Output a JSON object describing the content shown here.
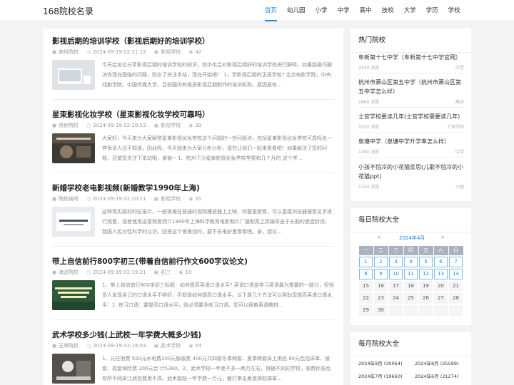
{
  "site": {
    "logo": "168院校名录"
  },
  "nav": [
    "首页",
    "幼儿园",
    "小学",
    "中学",
    "高中",
    "技校",
    "大学",
    "学历",
    "学校"
  ],
  "articles": [
    {
      "title": "影视后期的培训学校（影视后期好的培训学校）",
      "author": "商科院校",
      "date": "2024-09-19 02:21:12",
      "category": "影视学校",
      "views": "42",
      "excerpt": "今天给各位分享影视后期的培训学校的知识，其中也会对影视后期好的培训学校进行解释，如果能碰巧解决你现在面临的问题，别忘了关注本站，现在开始吧！ 1、学影视后期的正规学校? 北京电影学院，中央戏剧学院，中国传媒大学。目前国内有很多影视后期制作的培训机构，原因是有...",
      "thumb_bg": "#dfe3e8",
      "thumb_fg": "#ffffff"
    },
    {
      "title": "星束影视化妆学校（星束影视化妆学校可靠吗）",
      "author": "京剧院校",
      "date": "2024-09-19 02:20:53",
      "category": "影视学校",
      "views": "39",
      "excerpt": "大家好，今天来为大家解答星束影视化妆学校这个问题的一些问题点，包括星束影视化妆学校可靠吗也一样很多人还不知道，因此呢，今天就来为大家分析分析，现在让我们一起来看看吧！如果解决了您的问题，还望您关注下本站哦，谢谢~ 1、杭州下沙星束影视化妆学校学费和几个月的 这个学...",
      "thumb_bg": "#3d3a36",
      "thumb_fg": "#d8c9b0"
    },
    {
      "title": "新婚学校老电影视频(新婚教学1990年上海)",
      "author": "院校编号",
      "date": "2024-09-19 02:20:11",
      "category": "影视学校",
      "views": "31",
      "excerpt": "这种现实题材的纪录片，一般很难在普通的视频播放器上上映，你要是想看，可以直接浏览器搜索名字进行观看，或者使用迅雷观看而介1990年上海科学教育电影制片厂摄制英之英编导由于长期的思想封闭，我国人民对性科学的认识。回答这个很难找的，要不去电驴里看看吧。亲，建议...",
      "thumb_bg": "#e9ebee",
      "thumb_fg": "#4a5560"
    },
    {
      "title": "带上自信前行800字初三(带着自信前行作文600字议论文)",
      "author": "海淀院校",
      "date": "2024-09-19 02:19:21",
      "category": "初三",
      "views": "19",
      "excerpt": "1、带上自信前行800字初三标题：如何提高英语口语水平? 英语口语是学习英语最为重要的一部分，但很多人发现自己的口语水平不够好，不知道如何提高口语水平。以下是几个方法可以帮助您提高英语口语水平：1. 练习口语：要提高口语水平，就必须要多练习口语。您可以跟着英语教材...",
      "thumb_bg": "#2f5a3a",
      "thumb_fg": "#f3f0c0"
    },
    {
      "title": "武术学校多少钱(上武校一年学费大概多少钱)",
      "author": "玉林院校",
      "date": "2024-09-19 02:18:03",
      "category": "武术学校",
      "views": "54",
      "excerpt": "1、元住宿费 500元水电费200元服装费 400元共四套冬季两套、夏季两套床上用品 80元包括床单、被 套、枕套保险费 200元合 计5380。2、武术学校一年差不多一两万左右，根据不同的学校，收费标准也有所不同宋江武校费用不高，武术套路一年学费一万元，散打拳击柔道摔跤擒拿...",
      "thumb_bg": "#55504a",
      "thumb_fg": "#ffffff"
    }
  ],
  "hot": {
    "heading": "热门院校",
    "items": [
      {
        "title": "阜新第十七中学（阜新第十七中学官网）",
        "views": "2439 浏览",
        "tag": "中学"
      },
      {
        "title": "杭州市萧山区第五中学（杭州市萧山区第五中学怎么样）",
        "views": "1868 浏览",
        "tag": "高中"
      },
      {
        "title": "士官学校要读几年(士官学校需要读几年)",
        "views": "1520 浏览",
        "tag": "士官学校"
      },
      {
        "title": "泉塘中学（泉塘中学升学率怎么样）",
        "views": "1380 浏览",
        "tag": "中学"
      },
      {
        "title": "小孩不怕冷的小花猫反思(儿歌不怕冷的小花猫ppt)",
        "views": "1344 浏览",
        "tag": "小班"
      }
    ]
  },
  "calendar": {
    "heading": "每日院校大全",
    "prev": "«",
    "month": "2024年4月",
    "next": "»",
    "weekdays": [
      "一",
      "二",
      "三",
      "四",
      "五",
      "六",
      "日"
    ],
    "rows": [
      [
        "1",
        "2",
        "3",
        "4",
        "5",
        "6",
        "7"
      ],
      [
        "8",
        "9",
        "10",
        "11",
        "12",
        "13",
        "14"
      ],
      [
        "15",
        "16",
        "17",
        "18",
        "19",
        "20",
        "21"
      ],
      [
        "22",
        "23",
        "24",
        "25",
        "26",
        "27",
        "28"
      ],
      [
        "29",
        "30",
        "",
        "",
        "",
        "",
        ""
      ]
    ],
    "linked_through": 14
  },
  "monthly": {
    "heading": "每月院校大全",
    "items": [
      "2024年9月 (30064)",
      "2024年8月 (25599)",
      "2024年7月 (19660)",
      "2024年6月 (21274)"
    ]
  },
  "colors": {
    "accent": "#1e88e5",
    "header_gray": "#aab2bd"
  }
}
